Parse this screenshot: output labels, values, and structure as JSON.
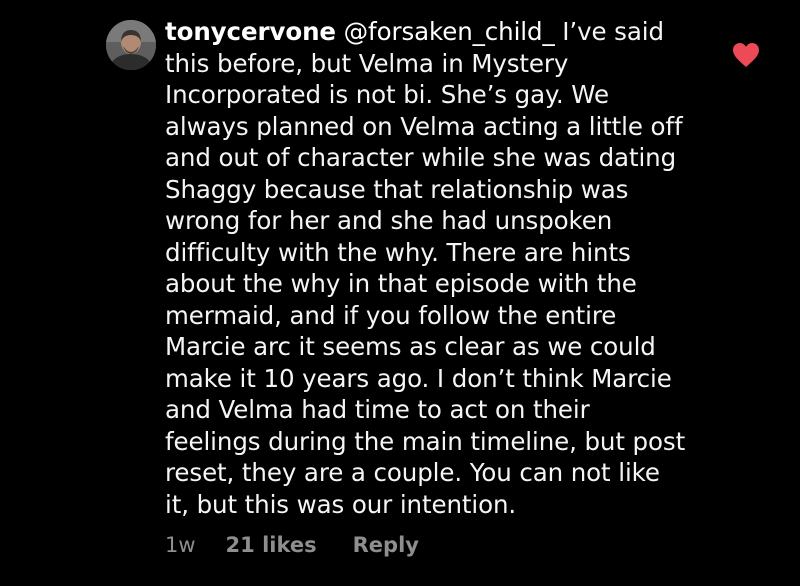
{
  "comment": {
    "username": "tonycervone",
    "mention": "@forsaken_child_",
    "first_line_rest": " I’ve said",
    "lines": [
      "this before, but Velma in Mystery",
      "Incorporated is not bi. She’s gay. We",
      "always planned on Velma acting a little off",
      "and out of character while she was dating",
      "Shaggy because that relationship was",
      "wrong for her and she had unspoken",
      "difficulty with the why. There are hints",
      "about the why in that episode with the",
      "mermaid, and if you follow the entire",
      "Marcie arc it seems as clear as we could",
      "make it 10 years ago. I don’t think Marcie",
      "and Velma had time to act on their",
      "feelings during the main timeline, but post",
      "reset, they are a couple. You can not like",
      "it, but this was our intention."
    ],
    "liked": true,
    "like_icon": "heart-icon",
    "like_color": "#ed4956",
    "meta": {
      "timestamp": "1w",
      "likes": "21 likes",
      "reply_label": "Reply"
    }
  },
  "colors": {
    "background": "#000000",
    "text": "#f5f5f5",
    "meta_text": "#8e8e8e"
  }
}
